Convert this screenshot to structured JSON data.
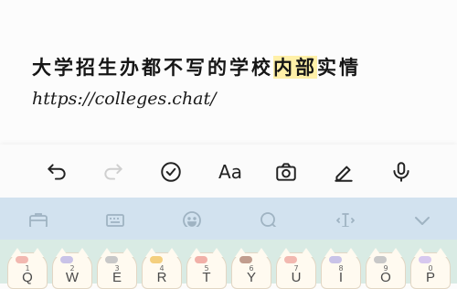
{
  "note": {
    "title_pre": "大学招生办都不写的学校",
    "title_hl": "内部",
    "title_post": "实情",
    "url": "https://colleges.chat/"
  },
  "toolbar": {
    "undo_icon": "undo-icon",
    "redo_icon": "redo-icon",
    "check_icon": "checkmark-circle-icon",
    "format_label": "Aa",
    "camera_icon": "camera-icon",
    "pen_icon": "pen-icon",
    "mic_icon": "microphone-icon"
  },
  "keyboard_bar": {
    "icons": [
      "briefcase-icon",
      "keyboard-icon",
      "emoji-icon",
      "search-icon",
      "cursor-move-icon",
      "chevron-down-icon"
    ]
  },
  "keys": [
    {
      "num": "1",
      "letter": "Q",
      "color": "#f2b8b0"
    },
    {
      "num": "2",
      "letter": "W",
      "color": "#c9c3e8"
    },
    {
      "num": "3",
      "letter": "E",
      "color": "#c8c8c8"
    },
    {
      "num": "4",
      "letter": "R",
      "color": "#f4cf7e"
    },
    {
      "num": "5",
      "letter": "T",
      "color": "#f1b0a8"
    },
    {
      "num": "6",
      "letter": "Y",
      "color": "#c19d8e"
    },
    {
      "num": "7",
      "letter": "U",
      "color": "#f2b8b0"
    },
    {
      "num": "8",
      "letter": "I",
      "color": "#c9c3e8"
    },
    {
      "num": "9",
      "letter": "O",
      "color": "#c8c8c8"
    },
    {
      "num": "0",
      "letter": "P",
      "color": "#d7c8ef"
    }
  ],
  "colors": {
    "highlight": "#fff0a8",
    "keyboard_bar": "#d2e2ef",
    "keyboard_bg": "#d9ebe4"
  }
}
